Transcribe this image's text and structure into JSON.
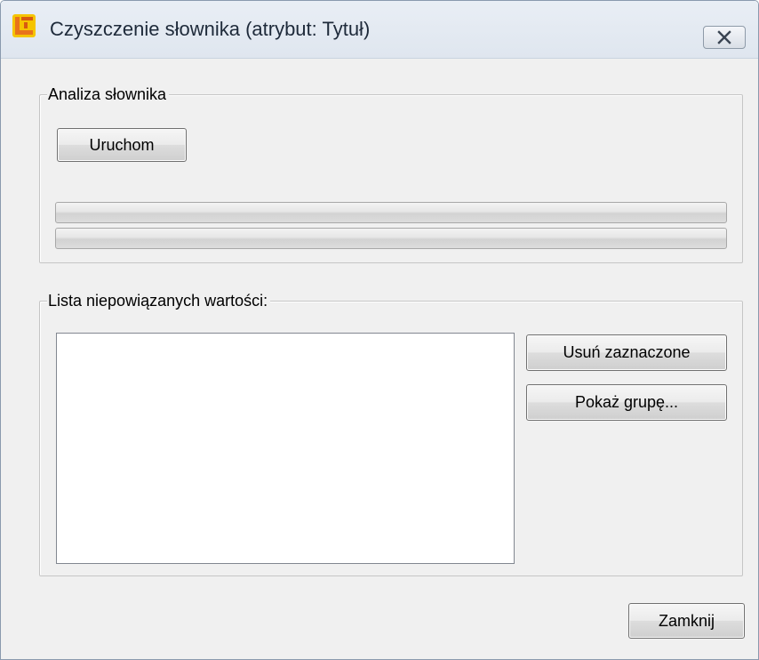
{
  "window": {
    "title": "Czyszczenie słownika (atrybut: Tytuł)",
    "icon": "app-logo-icon",
    "close_icon": "close-icon"
  },
  "analysis_group": {
    "legend": "Analiza słownika",
    "run_button_label": "Uruchom",
    "progress_bars": [
      {
        "name": "progress-bar-1",
        "value": 0
      },
      {
        "name": "progress-bar-2",
        "value": 0
      }
    ]
  },
  "values_group": {
    "legend": "Lista niepowiązanych wartości:",
    "list_items": [],
    "delete_selected_label": "Usuń zaznaczone",
    "show_group_label": "Pokaż grupę..."
  },
  "footer": {
    "close_label": "Zamknij"
  },
  "colors": {
    "window_bg": "#f0f0f0",
    "titlebar_bg": "#dfe6ef",
    "icon_orange": "#e8731a",
    "icon_yellow": "#f5c400"
  }
}
